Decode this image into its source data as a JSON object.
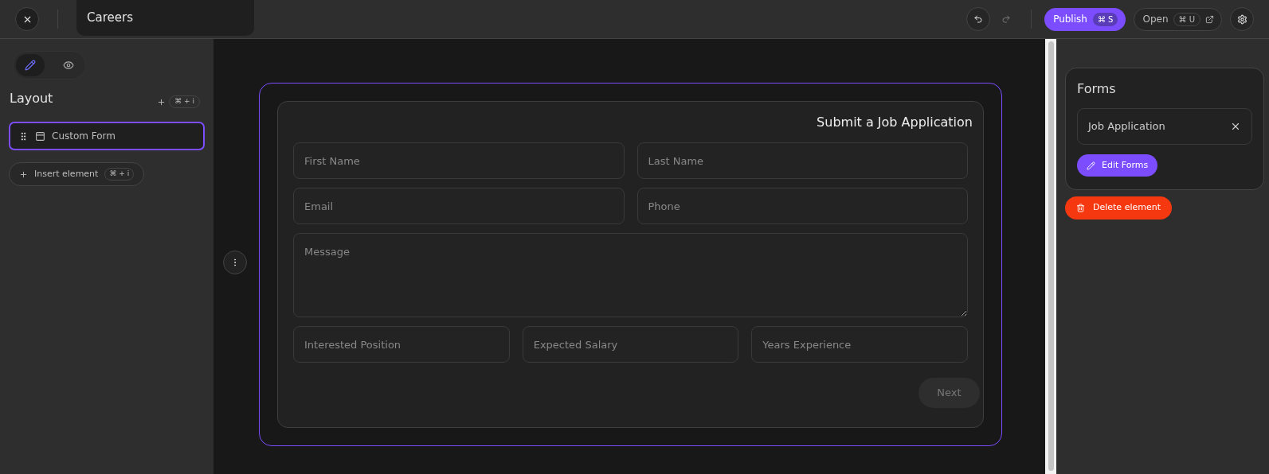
{
  "topbar": {
    "page_title": "Careers",
    "publish": {
      "label": "Publish",
      "shortcut": "⌘ S"
    },
    "open": {
      "label": "Open",
      "shortcut": "⌘ U"
    }
  },
  "sidebar": {
    "modes": [
      {
        "kind": "edit",
        "selected": true
      },
      {
        "kind": "preview",
        "selected": false
      }
    ],
    "heading": "Layout",
    "add_shortcut": "⌘ + i",
    "items": [
      {
        "label": "Custom Form",
        "selected": true
      }
    ],
    "insert": {
      "label": "Insert element",
      "shortcut": "⌘ + i"
    }
  },
  "form": {
    "title": "Submit a Job Application",
    "rows": [
      {
        "fields": [
          {
            "placeholder": "First Name",
            "kind": "input"
          },
          {
            "placeholder": "Last Name",
            "kind": "input"
          }
        ]
      },
      {
        "fields": [
          {
            "placeholder": "Email",
            "kind": "input"
          },
          {
            "placeholder": "Phone",
            "kind": "input"
          }
        ]
      },
      {
        "fields": [
          {
            "placeholder": "Message",
            "kind": "textarea"
          }
        ]
      },
      {
        "fields": [
          {
            "placeholder": "Interested Position",
            "kind": "input"
          },
          {
            "placeholder": "Expected Salary",
            "kind": "input"
          },
          {
            "placeholder": "Years Experience",
            "kind": "input"
          }
        ]
      }
    ],
    "submit": {
      "label": "Next",
      "disabled": true
    }
  },
  "panel": {
    "heading": "Forms",
    "selected_form": "Job Application",
    "edit_button": "Edit Forms",
    "delete_button": "Delete element"
  }
}
